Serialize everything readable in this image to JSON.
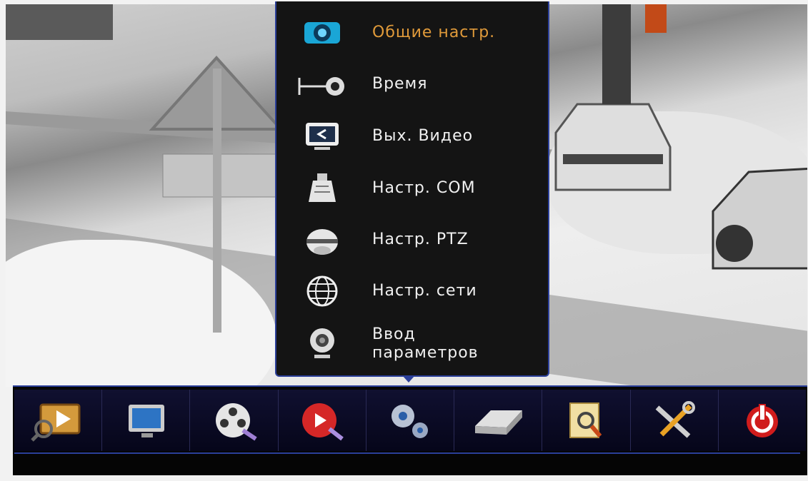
{
  "menu": {
    "items": [
      {
        "label": "Общие настр.",
        "icon": "gear-settings-icon",
        "selected": true
      },
      {
        "label": "Время",
        "icon": "clock-time-icon",
        "selected": false
      },
      {
        "label": "Вых. Видео",
        "icon": "monitor-output-icon",
        "selected": false
      },
      {
        "label": "Настр. COM",
        "icon": "com-port-icon",
        "selected": false
      },
      {
        "label": "Настр. PTZ",
        "icon": "ptz-camera-icon",
        "selected": false
      },
      {
        "label": "Настр. сети",
        "icon": "globe-network-icon",
        "selected": false
      },
      {
        "label": "Ввод\nпараметров",
        "icon": "webcam-input-icon",
        "selected": false
      }
    ]
  },
  "taskbar": {
    "buttons": [
      {
        "name": "search-playback-button",
        "icon": "search-playback-icon"
      },
      {
        "name": "display-button",
        "icon": "monitor-icon"
      },
      {
        "name": "record-settings-button",
        "icon": "film-reel-icon"
      },
      {
        "name": "alarm-settings-button",
        "icon": "record-alarm-icon"
      },
      {
        "name": "system-settings-button",
        "icon": "gears-icon"
      },
      {
        "name": "hdd-button",
        "icon": "hard-drive-icon"
      },
      {
        "name": "info-button",
        "icon": "document-magnifier-icon"
      },
      {
        "name": "tools-button",
        "icon": "tools-icon"
      },
      {
        "name": "power-button",
        "icon": "power-icon"
      }
    ]
  },
  "colors": {
    "menu_bg": "#141414",
    "border": "#2b3f9a",
    "selected_text": "#e09a3a",
    "text": "#f1f1f1"
  }
}
